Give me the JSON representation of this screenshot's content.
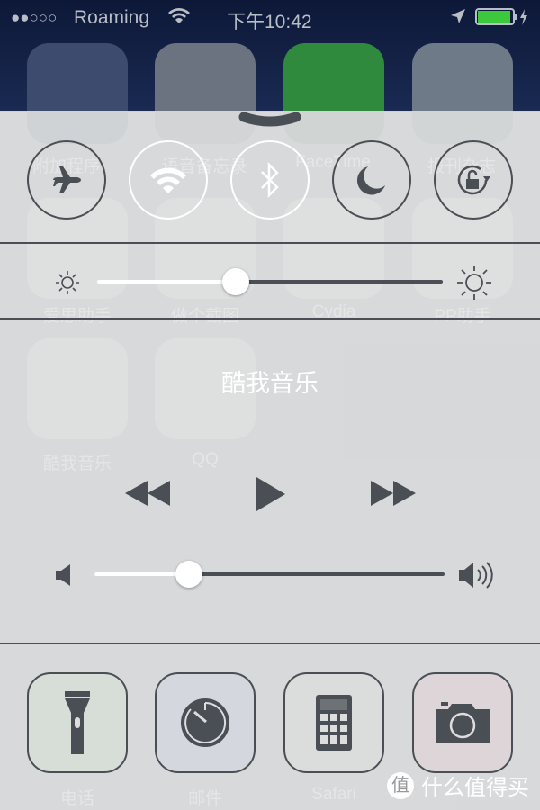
{
  "status_bar": {
    "signal": "●●○○○",
    "carrier": "Roaming",
    "time": "下午10:42",
    "battery_color": "#3cc83c"
  },
  "background_apps": [
    "附加程序",
    "语音备忘录",
    "FaceTime",
    "报刊杂志",
    "爱思助手",
    "做个截图",
    "Cydia",
    "PP助手",
    "酷我音乐",
    "QQ",
    "电话",
    "邮件",
    "Safari"
  ],
  "toggles": [
    {
      "name": "airplane-mode",
      "icon": "airplane-icon",
      "on": false
    },
    {
      "name": "wifi",
      "icon": "wifi-icon",
      "on": true
    },
    {
      "name": "bluetooth",
      "icon": "bluetooth-icon",
      "on": true
    },
    {
      "name": "do-not-disturb",
      "icon": "moon-icon",
      "on": false
    },
    {
      "name": "rotation-lock",
      "icon": "rotation-lock-icon",
      "on": false
    }
  ],
  "brightness": {
    "level": 0.4
  },
  "music": {
    "title": "酷我音乐",
    "volume": 0.27
  },
  "shortcuts": [
    "flashlight",
    "timer",
    "calculator",
    "camera"
  ],
  "watermark": {
    "badge": "值",
    "text": "什么值得买"
  },
  "colors": {
    "panel": "#d4d6d8",
    "icon": "#4a4f55",
    "track_filled": "#ffffff",
    "track_empty": "#4a4f55"
  }
}
